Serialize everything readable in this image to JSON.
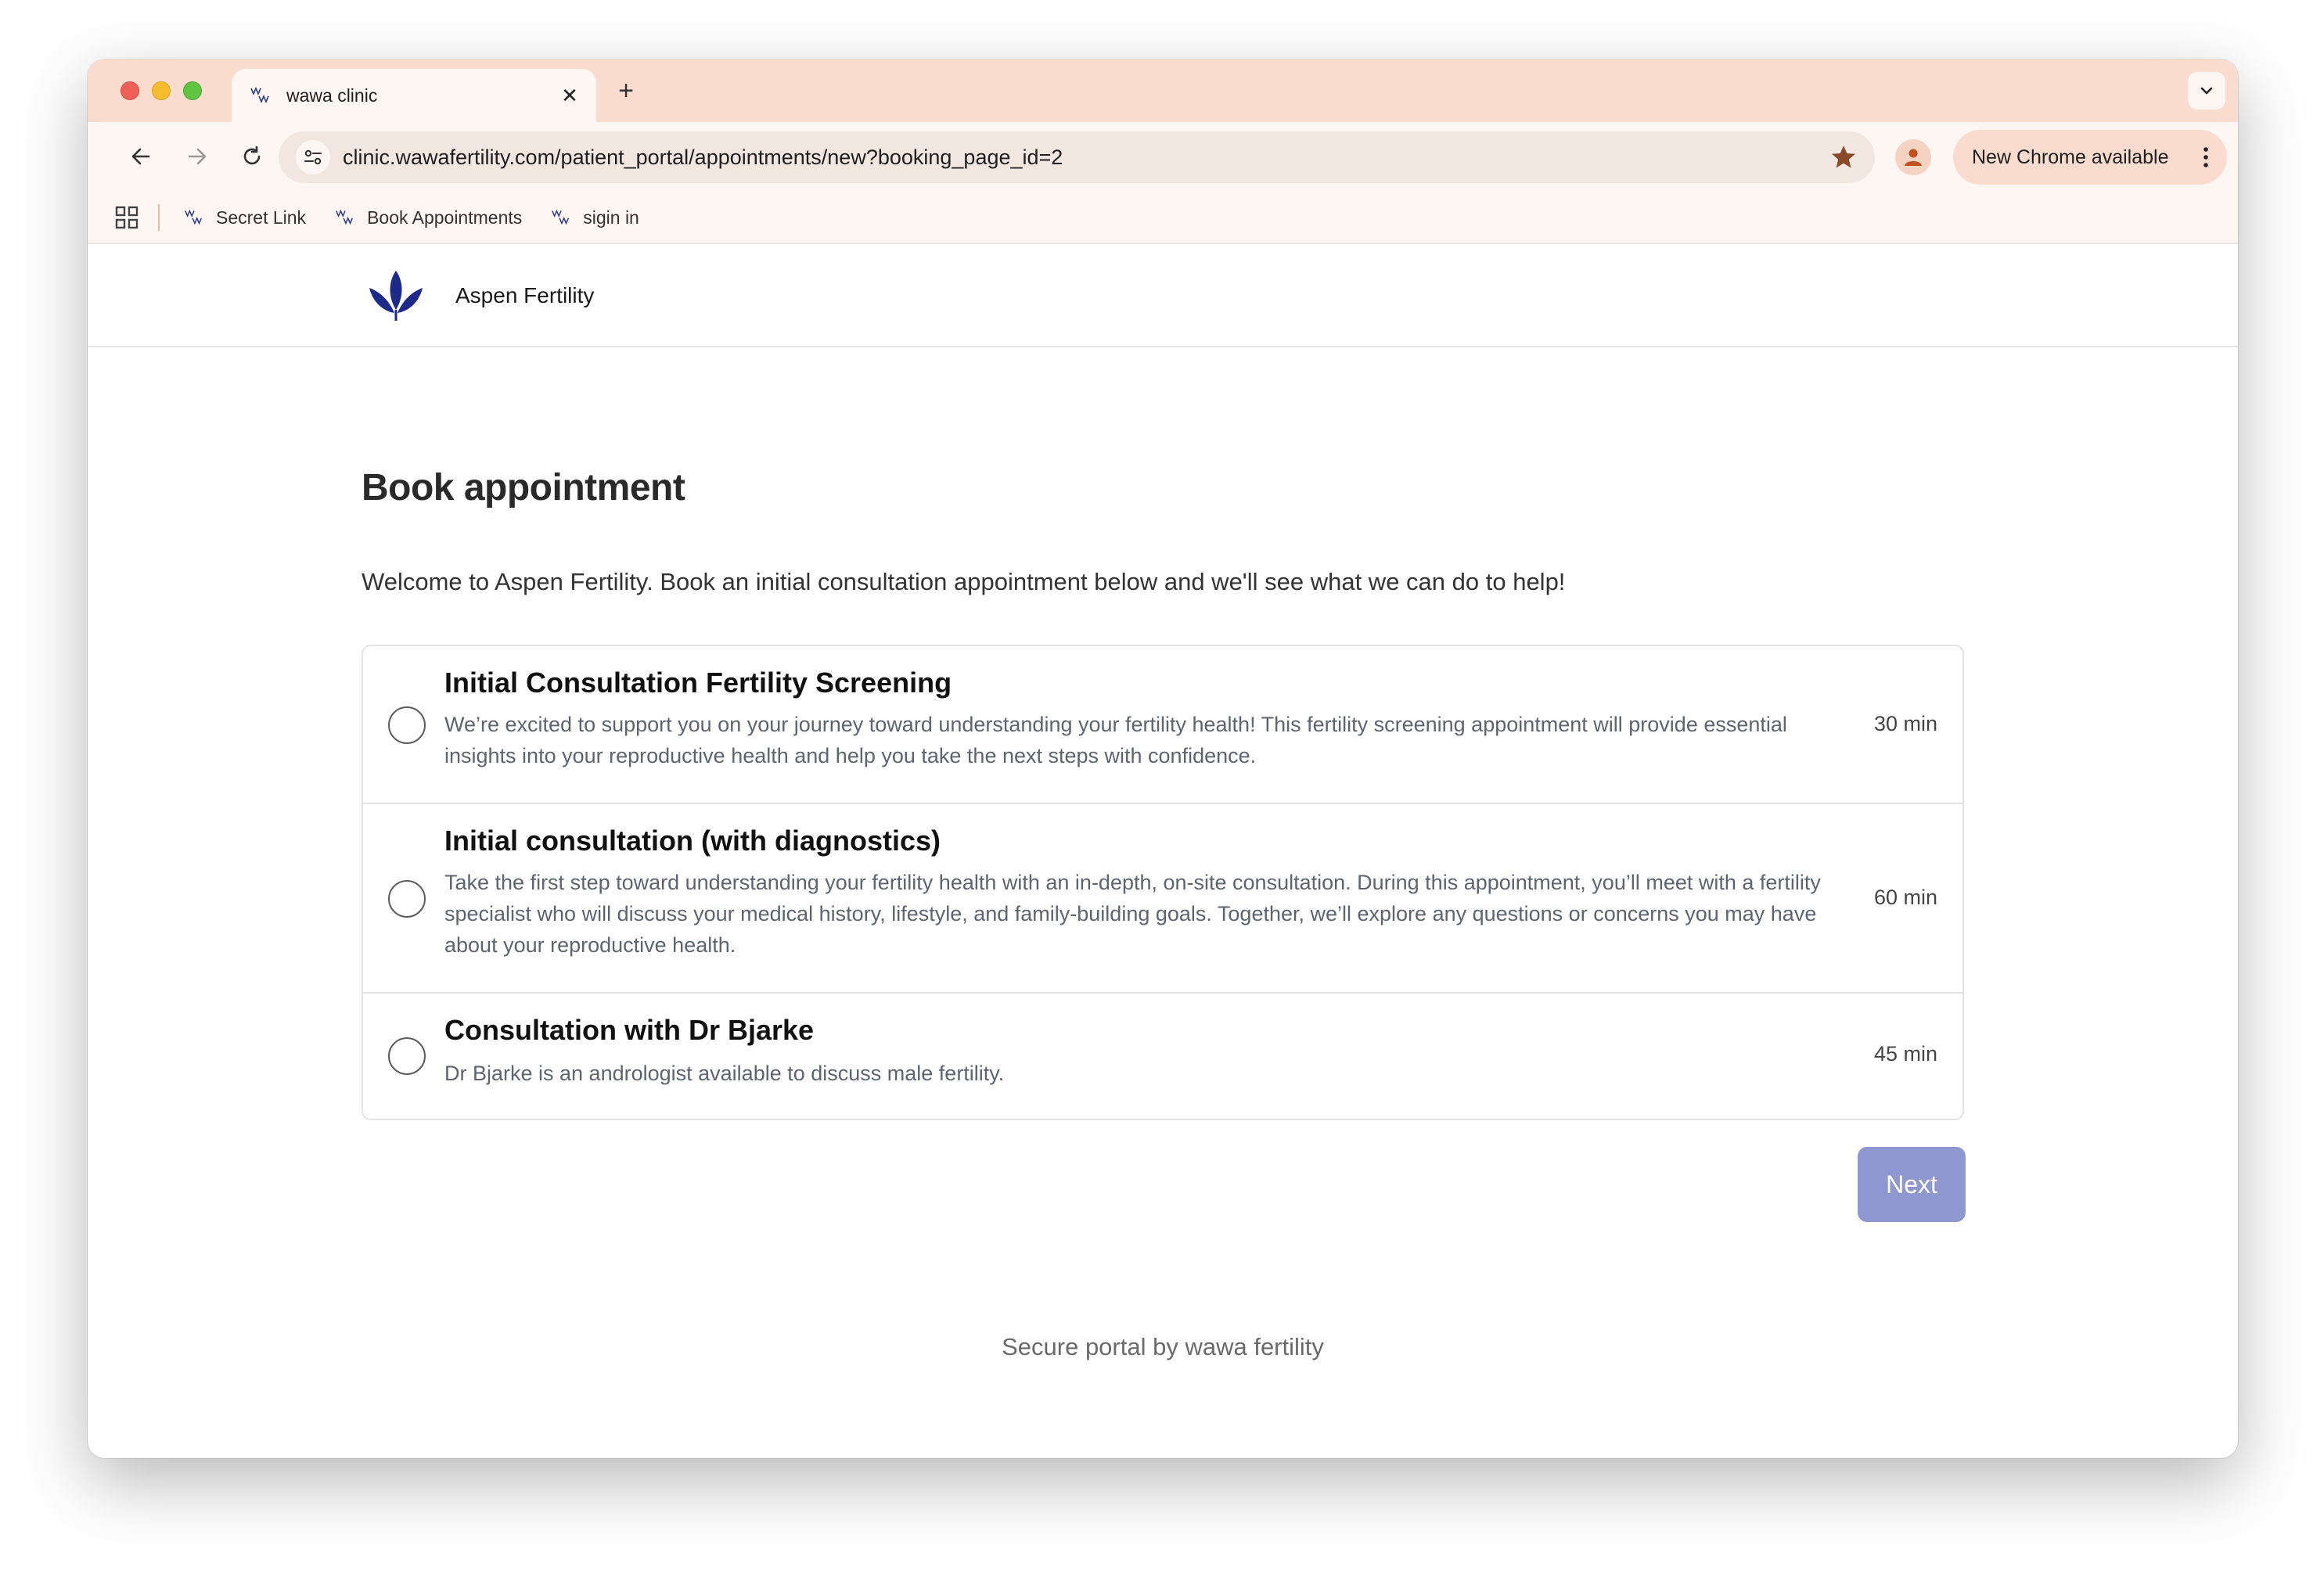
{
  "browser": {
    "tab": {
      "title": "wawa clinic",
      "close_glyph": "✕"
    },
    "new_tab_glyph": "+",
    "url": "clinic.wawafertility.com/patient_portal/appointments/new?booking_page_id=2",
    "update_label": "New Chrome available",
    "bookmarks": [
      {
        "label": "Secret Link"
      },
      {
        "label": "Book Appointments"
      },
      {
        "label": "sigin in"
      }
    ],
    "colors": {
      "tabstrip": "#f9dccd",
      "toolbar": "#fdf6f2",
      "accent": "#a0522d"
    }
  },
  "site": {
    "brand": "Aspen Fertility",
    "logo_color": "#1e2a8a"
  },
  "page": {
    "title": "Book appointment",
    "intro": "Welcome to Aspen Fertility. Book an initial consultation appointment below and we'll see what we can do to help!",
    "options": [
      {
        "name": "Initial Consultation Fertility Screening",
        "description": "We’re excited to support you on your journey toward understanding your fertility health! This fertility screening appointment will provide essential insights into your reproductive health and help you take the next steps with confidence.",
        "duration": "30 min",
        "selected": false
      },
      {
        "name": "Initial consultation (with diagnostics)",
        "description": "Take the first step toward understanding your fertility health with an in-depth, on-site consultation. During this appointment, you’ll meet with a fertility specialist who will discuss your medical history, lifestyle, and family-building goals. Together, we’ll explore any questions or concerns you may have about your reproductive health.",
        "duration": "60 min",
        "selected": false
      },
      {
        "name": "Consultation with Dr Bjarke",
        "description": "Dr Bjarke is an andrologist available to discuss male fertility.",
        "duration": "45 min",
        "selected": false
      }
    ],
    "next_label": "Next",
    "next_color": "#8e97cf",
    "footer": "Secure portal by wawa fertility"
  }
}
